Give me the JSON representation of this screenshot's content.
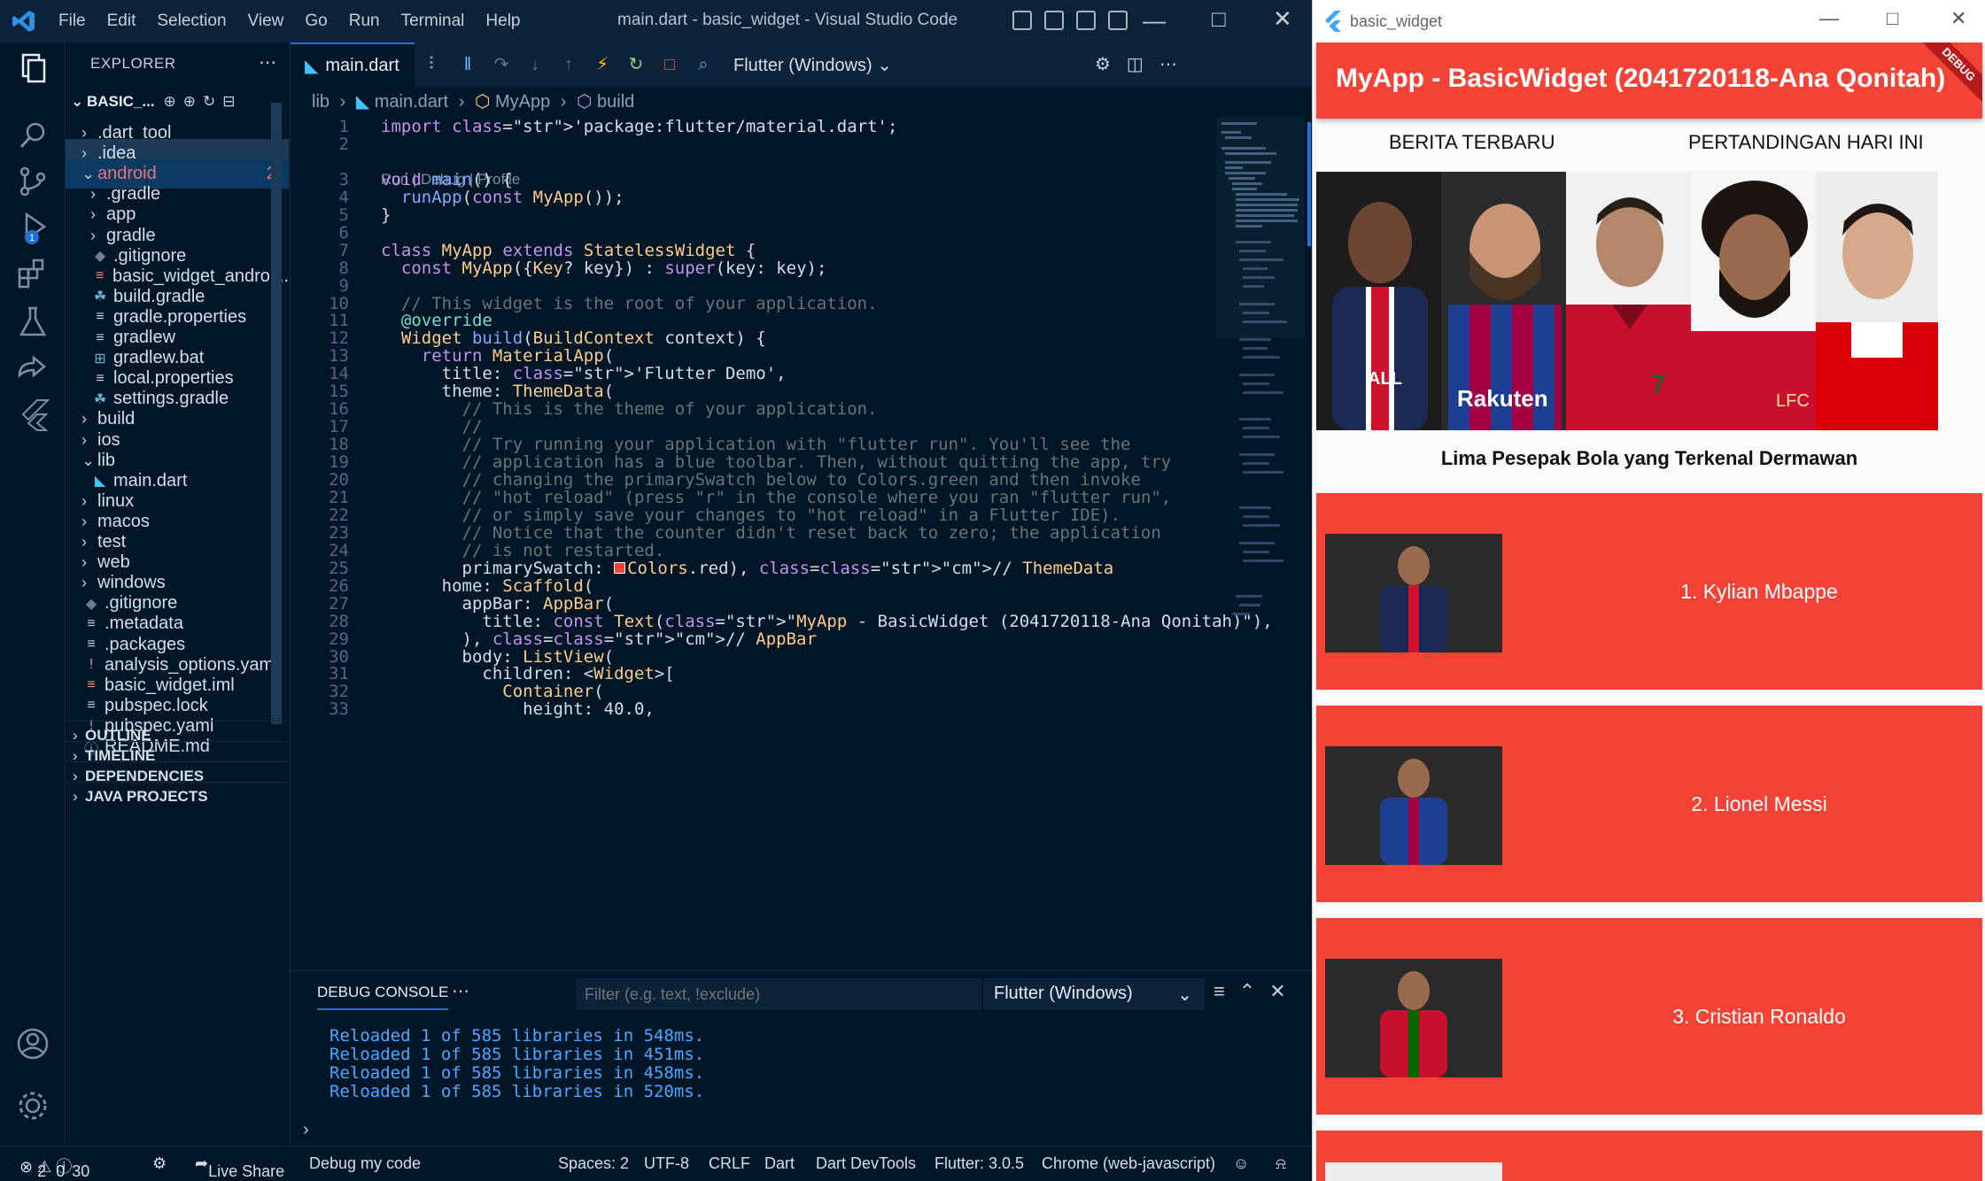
{
  "vscode": {
    "menu": [
      "File",
      "Edit",
      "Selection",
      "View",
      "Go",
      "Run",
      "Terminal",
      "Help"
    ],
    "window_title": "main.dart - basic_widget - Visual Studio Code",
    "explorer": {
      "title": "EXPLORER",
      "root": "BASIC_...",
      "items": [
        {
          "label": ".dart_tool",
          "kind": "folder"
        },
        {
          "label": ".idea",
          "kind": "folder"
        },
        {
          "label": "android",
          "kind": "folder-open",
          "badge": "2"
        },
        {
          "label": ".gradle",
          "kind": "folder"
        },
        {
          "label": "app",
          "kind": "folder"
        },
        {
          "label": "gradle",
          "kind": "folder"
        },
        {
          "label": ".gitignore",
          "kind": "file"
        },
        {
          "label": "basic_widget_androi...",
          "kind": "file"
        },
        {
          "label": "build.gradle",
          "kind": "file"
        },
        {
          "label": "gradle.properties",
          "kind": "file"
        },
        {
          "label": "gradlew",
          "kind": "file"
        },
        {
          "label": "gradlew.bat",
          "kind": "file"
        },
        {
          "label": "local.properties",
          "kind": "file"
        },
        {
          "label": "settings.gradle",
          "kind": "file"
        },
        {
          "label": "build",
          "kind": "folder"
        },
        {
          "label": "ios",
          "kind": "folder"
        },
        {
          "label": "lib",
          "kind": "folder-open"
        },
        {
          "label": "main.dart",
          "kind": "file"
        },
        {
          "label": "linux",
          "kind": "folder"
        },
        {
          "label": "macos",
          "kind": "folder"
        },
        {
          "label": "test",
          "kind": "folder"
        },
        {
          "label": "web",
          "kind": "folder"
        },
        {
          "label": "windows",
          "kind": "folder"
        },
        {
          "label": ".gitignore",
          "kind": "file"
        },
        {
          "label": ".metadata",
          "kind": "file"
        },
        {
          "label": ".packages",
          "kind": "file"
        },
        {
          "label": "analysis_options.yaml",
          "kind": "file"
        },
        {
          "label": "basic_widget.iml",
          "kind": "file"
        },
        {
          "label": "pubspec.lock",
          "kind": "file"
        },
        {
          "label": "pubspec.yaml",
          "kind": "file"
        },
        {
          "label": "README.md",
          "kind": "file"
        }
      ],
      "sections": [
        "OUTLINE",
        "TIMELINE",
        "DEPENDENCIES",
        "JAVA PROJECTS"
      ]
    },
    "tab": {
      "label": "main.dart"
    },
    "device_select": "Flutter (Windows)",
    "breadcrumb": [
      "lib",
      "main.dart",
      "MyApp",
      "build"
    ],
    "codelens": "Run | Debug | Profile",
    "code_lines": [
      {
        "n": "1",
        "t": "import 'package:flutter/material.dart';"
      },
      {
        "n": "2",
        "t": ""
      },
      {
        "n": "3",
        "t": "void main() {"
      },
      {
        "n": "4",
        "t": "  runApp(const MyApp());"
      },
      {
        "n": "5",
        "t": "}"
      },
      {
        "n": "6",
        "t": ""
      },
      {
        "n": "7",
        "t": "class MyApp extends StatelessWidget {"
      },
      {
        "n": "8",
        "t": "  const MyApp({Key? key}) : super(key: key);"
      },
      {
        "n": "9",
        "t": ""
      },
      {
        "n": "10",
        "t": "  // This widget is the root of your application."
      },
      {
        "n": "11",
        "t": "  @override"
      },
      {
        "n": "12",
        "t": "  Widget build(BuildContext context) {"
      },
      {
        "n": "13",
        "t": "    return MaterialApp("
      },
      {
        "n": "14",
        "t": "      title: 'Flutter Demo',"
      },
      {
        "n": "15",
        "t": "      theme: ThemeData("
      },
      {
        "n": "16",
        "t": "        // This is the theme of your application."
      },
      {
        "n": "17",
        "t": "        //"
      },
      {
        "n": "18",
        "t": "        // Try running your application with \"flutter run\". You'll see the"
      },
      {
        "n": "19",
        "t": "        // application has a blue toolbar. Then, without quitting the app, try"
      },
      {
        "n": "20",
        "t": "        // changing the primarySwatch below to Colors.green and then invoke"
      },
      {
        "n": "21",
        "t": "        // \"hot reload\" (press \"r\" in the console where you ran \"flutter run\","
      },
      {
        "n": "22",
        "t": "        // or simply save your changes to \"hot reload\" in a Flutter IDE)."
      },
      {
        "n": "23",
        "t": "        // Notice that the counter didn't reset back to zero; the application"
      },
      {
        "n": "24",
        "t": "        // is not restarted."
      },
      {
        "n": "25",
        "t": "        primarySwatch: ■Colors.red), // ThemeData"
      },
      {
        "n": "26",
        "t": "      home: Scaffold("
      },
      {
        "n": "27",
        "t": "        appBar: AppBar("
      },
      {
        "n": "28",
        "t": "          title: const Text(\"MyApp - BasicWidget (2041720118-Ana Qonitah)\"),"
      },
      {
        "n": "29",
        "t": "        ), // AppBar"
      },
      {
        "n": "30",
        "t": "        body: ListView("
      },
      {
        "n": "31",
        "t": "          children: <Widget>["
      },
      {
        "n": "32",
        "t": "            Container("
      },
      {
        "n": "33",
        "t": "              height: 40.0,"
      }
    ],
    "panel": {
      "tab": "DEBUG CONSOLE",
      "filter_placeholder": "Filter (e.g. text, !exclude)",
      "target": "Flutter (Windows)",
      "lines": [
        "Reloaded 1 of 585 libraries in 548ms.",
        "Reloaded 1 of 585 libraries in 451ms.",
        "Reloaded 1 of 585 libraries in 458ms.",
        "Reloaded 1 of 585 libraries in 520ms."
      ]
    },
    "status": {
      "errors": "2",
      "warnings": "0",
      "info": "30",
      "live_share": "Live Share",
      "debug": "Debug my code",
      "spaces": "Spaces: 2",
      "encoding": "UTF-8",
      "eol": "CRLF",
      "language": "Dart",
      "devtools": "Dart DevTools",
      "flutter": "Flutter: 3.0.5",
      "device": "Chrome (web-javascript)"
    }
  },
  "flutter_app": {
    "window_title": "basic_widget",
    "appbar_title": "MyApp - BasicWidget (2041720118-Ana Qonitah)",
    "debug_banner": "DEBUG",
    "tab_left": "BERITA TERBARU",
    "tab_right": "PERTANDINGAN HARI INI",
    "caption": "Lima Pesepak Bola yang Terkenal Dermawan",
    "players": [
      {
        "label": "1. Kylian Mbappe",
        "jersey": "#1a2a55",
        "accent": "#d0112b"
      },
      {
        "label": "2. Lionel Messi",
        "jersey": "#1c3f94",
        "accent": "#a50044"
      },
      {
        "label": "3. Cristian Ronaldo",
        "jersey": "#c8102e",
        "accent": "#006600"
      }
    ],
    "colors": {
      "primary": "#f44336",
      "white": "#ffffff"
    }
  }
}
